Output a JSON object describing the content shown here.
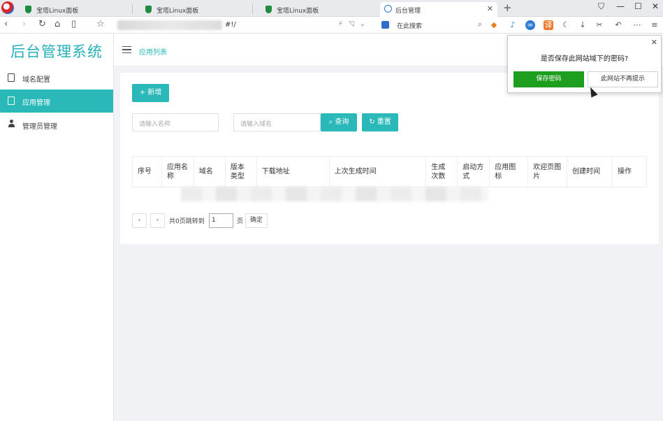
{
  "browser": {
    "tabs": [
      {
        "label": "宝塔Linux面板"
      },
      {
        "label": "宝塔Linux面板"
      },
      {
        "label": "宝塔Linux面板"
      },
      {
        "label": "后台管理",
        "active": true
      }
    ],
    "url_suffix": "#!/",
    "search_placeholder": "在此搜索",
    "window_controls": [
      "⛉",
      "—",
      "☐",
      "✕"
    ]
  },
  "sidebar": {
    "logo": "后台管理系统",
    "items": [
      {
        "label": "域名配置",
        "icon": "clipboard-icon"
      },
      {
        "label": "应用管理",
        "icon": "clipboard-icon",
        "active": true
      },
      {
        "label": "管理员管理",
        "icon": "user-icon"
      }
    ]
  },
  "header": {
    "breadcrumb": "应用列表"
  },
  "toolbar": {
    "add_label": "+ 新增",
    "name_placeholder": "请输入名称",
    "domain_placeholder": "请输入域名",
    "search_label": "查询",
    "reset_label": "重置"
  },
  "table": {
    "columns": [
      "序号",
      "应用名称",
      "域名",
      "版本类型",
      "下载地址",
      "上次生成时间",
      "生成次数",
      "启动方式",
      "应用图标",
      "欢迎页图片",
      "创建时间",
      "操作"
    ],
    "rows": []
  },
  "pagination": {
    "prev": "‹",
    "next": "›",
    "summary": "共0页跳转到",
    "page_value": "1",
    "page_suffix": "页",
    "confirm_label": "确定"
  },
  "password_prompt": {
    "question": "是否保存此网站域下的密码?",
    "save_label": "保存密码",
    "never_label": "此网站不再提示"
  },
  "colors": {
    "accent": "#2ab8b9",
    "save_green": "#1e9e1e"
  }
}
